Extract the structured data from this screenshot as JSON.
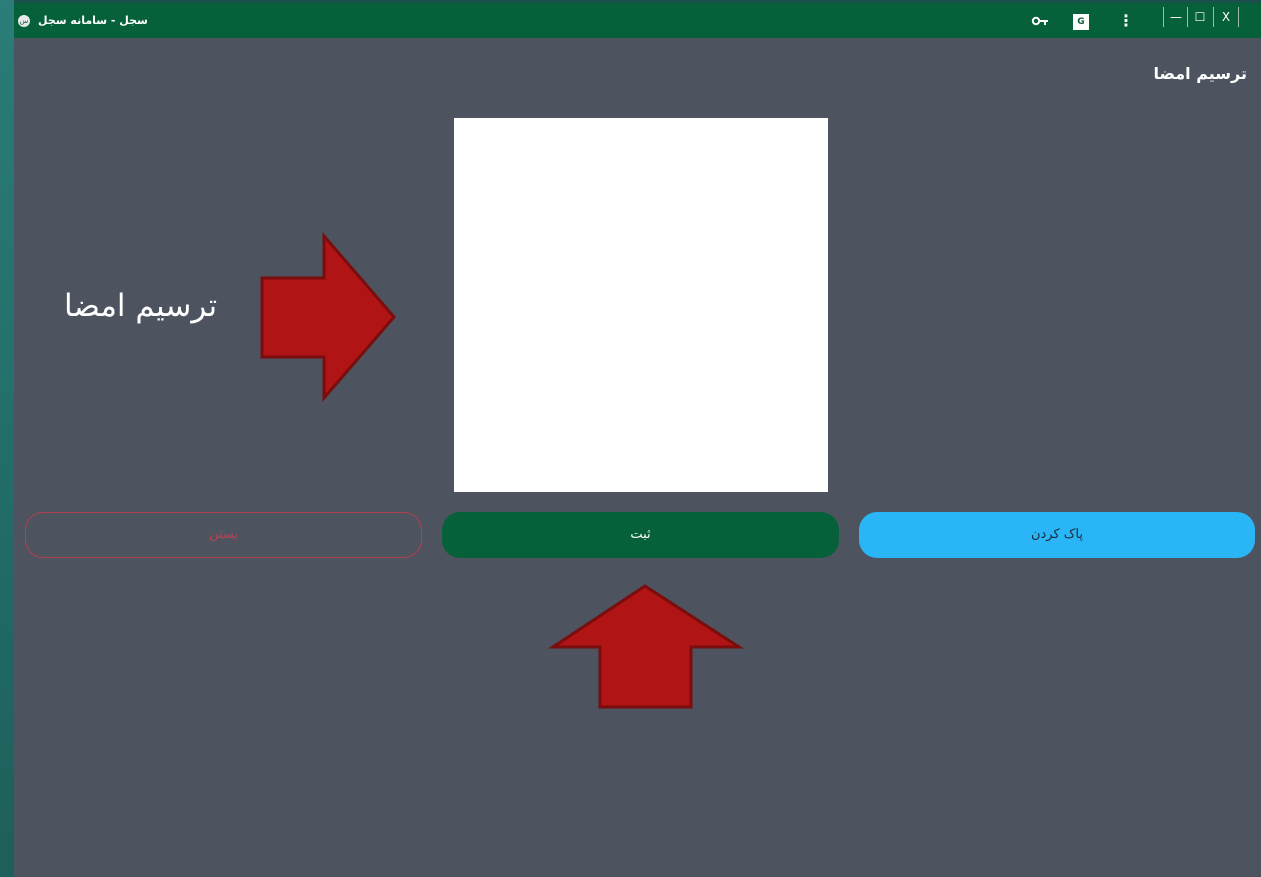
{
  "window": {
    "title": "سجل - سامانه سجل",
    "logo_text": "س",
    "icons": [
      "key-icon",
      "translate-icon",
      "menu-icon"
    ],
    "controls": {
      "minimize": "—",
      "maximize": "☐",
      "close": "X"
    }
  },
  "page": {
    "heading": "ترسیم امضا"
  },
  "signature_pad": {
    "background": "#ffffff"
  },
  "buttons": {
    "close_label": "بستن",
    "submit_label": "ثبت",
    "clear_label": "پاک کردن"
  },
  "annotation": {
    "label": "ترسیم امضا",
    "arrow_color": "#b01414"
  },
  "colors": {
    "titlebar": "#06613a",
    "background": "#4d535f",
    "submit": "#06613a",
    "clear": "#29b5f6",
    "close_outline": "#b04050"
  }
}
